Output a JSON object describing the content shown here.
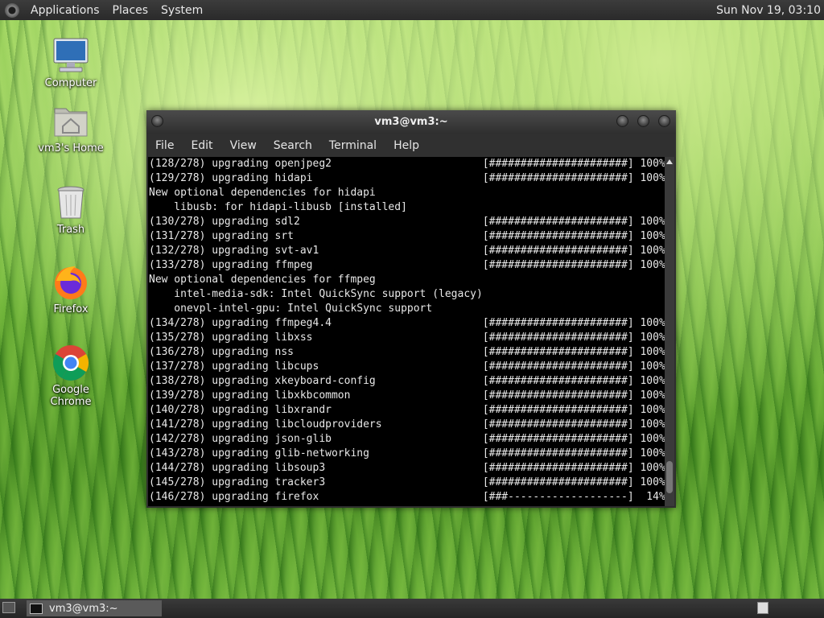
{
  "top_panel": {
    "menus": [
      "Applications",
      "Places",
      "System"
    ],
    "clock": "Sun Nov 19, 03:10"
  },
  "desktop_icons": {
    "computer": "Computer",
    "home": "vm3's Home",
    "trash": "Trash",
    "firefox": "Firefox",
    "chrome": "Google Chrome"
  },
  "terminal": {
    "title": "vm3@vm3:~",
    "menu": [
      "File",
      "Edit",
      "View",
      "Search",
      "Terminal",
      "Help"
    ],
    "lines": [
      "(128/278) upgrading openjpeg2                        [######################] 100%",
      "(129/278) upgrading hidapi                           [######################] 100%",
      "New optional dependencies for hidapi",
      "    libusb: for hidapi-libusb [installed]",
      "(130/278) upgrading sdl2                             [######################] 100%",
      "(131/278) upgrading srt                              [######################] 100%",
      "(132/278) upgrading svt-av1                          [######################] 100%",
      "(133/278) upgrading ffmpeg                           [######################] 100%",
      "New optional dependencies for ffmpeg",
      "    intel-media-sdk: Intel QuickSync support (legacy)",
      "    onevpl-intel-gpu: Intel QuickSync support",
      "(134/278) upgrading ffmpeg4.4                        [######################] 100%",
      "(135/278) upgrading libxss                           [######################] 100%",
      "(136/278) upgrading nss                              [######################] 100%",
      "(137/278) upgrading libcups                          [######################] 100%",
      "(138/278) upgrading xkeyboard-config                 [######################] 100%",
      "(139/278) upgrading libxkbcommon                     [######################] 100%",
      "(140/278) upgrading libxrandr                        [######################] 100%",
      "(141/278) upgrading libcloudproviders                [######################] 100%",
      "(142/278) upgrading json-glib                        [######################] 100%",
      "(143/278) upgrading glib-networking                  [######################] 100%",
      "(144/278) upgrading libsoup3                         [######################] 100%",
      "(145/278) upgrading tracker3                         [######################] 100%",
      "(146/278) upgrading firefox                          [###-------------------]  14%"
    ]
  },
  "taskbar": {
    "task_label": "vm3@vm3:~"
  }
}
